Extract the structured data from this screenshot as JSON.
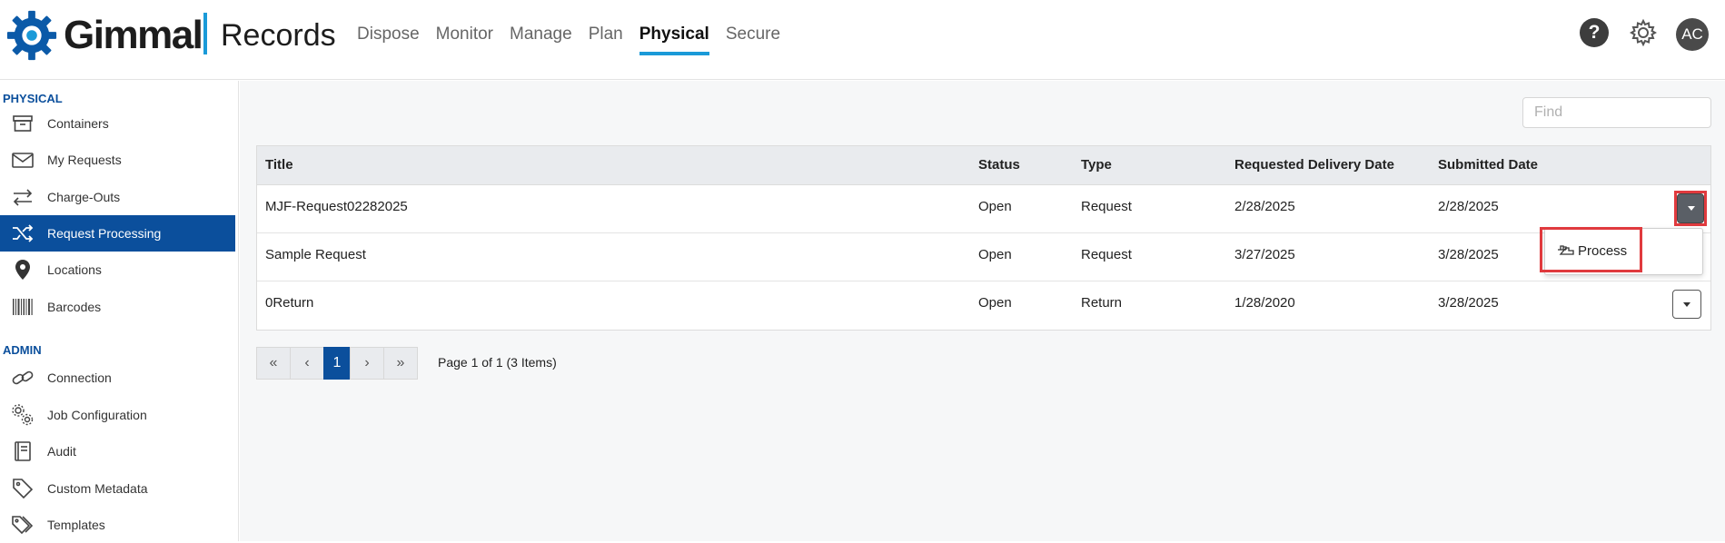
{
  "header": {
    "brand": "Gimmal",
    "product": "Records",
    "nav": [
      "Dispose",
      "Monitor",
      "Manage",
      "Plan",
      "Physical",
      "Secure"
    ],
    "active_nav": "Physical",
    "help_label": "?",
    "avatar_initials": "AC"
  },
  "sidebar": {
    "physical_label": "PHYSICAL",
    "physical_items": [
      {
        "label": "Containers",
        "icon": "archive-box-icon"
      },
      {
        "label": "My Requests",
        "icon": "envelope-icon"
      },
      {
        "label": "Charge-Outs",
        "icon": "swap-arrows-icon"
      },
      {
        "label": "Request Processing",
        "icon": "shuffle-icon"
      },
      {
        "label": "Locations",
        "icon": "map-pin-icon"
      },
      {
        "label": "Barcodes",
        "icon": "barcode-icon"
      }
    ],
    "active_item": "Request Processing",
    "admin_label": "ADMIN",
    "admin_items": [
      {
        "label": "Connection",
        "icon": "link-icon"
      },
      {
        "label": "Job Configuration",
        "icon": "gears-icon"
      },
      {
        "label": "Audit",
        "icon": "book-icon"
      },
      {
        "label": "Custom Metadata",
        "icon": "tag-icon"
      },
      {
        "label": "Templates",
        "icon": "tags-icon"
      }
    ]
  },
  "search": {
    "placeholder": "Find",
    "value": ""
  },
  "table": {
    "columns": [
      "Title",
      "Status",
      "Type",
      "Requested Delivery Date",
      "Submitted Date"
    ],
    "rows": [
      {
        "title": "MJF-Request02282025",
        "status": "Open",
        "type": "Request",
        "requested": "2/28/2025",
        "submitted": "2/28/2025"
      },
      {
        "title": "Sample Request",
        "status": "Open",
        "type": "Request",
        "requested": "3/27/2025",
        "submitted": "3/28/2025"
      },
      {
        "title": "0Return",
        "status": "Open",
        "type": "Return",
        "requested": "1/28/2020",
        "submitted": "3/28/2025"
      }
    ]
  },
  "row_menu": {
    "items": [
      "Process"
    ]
  },
  "pager": {
    "first": "«",
    "prev": "‹",
    "current": "1",
    "next": "›",
    "last": "»",
    "info": "Page 1 of 1 (3 Items)"
  },
  "colors": {
    "accent": "#1a9ad8",
    "primary": "#0b4f9c",
    "highlight": "#e03a3e"
  }
}
